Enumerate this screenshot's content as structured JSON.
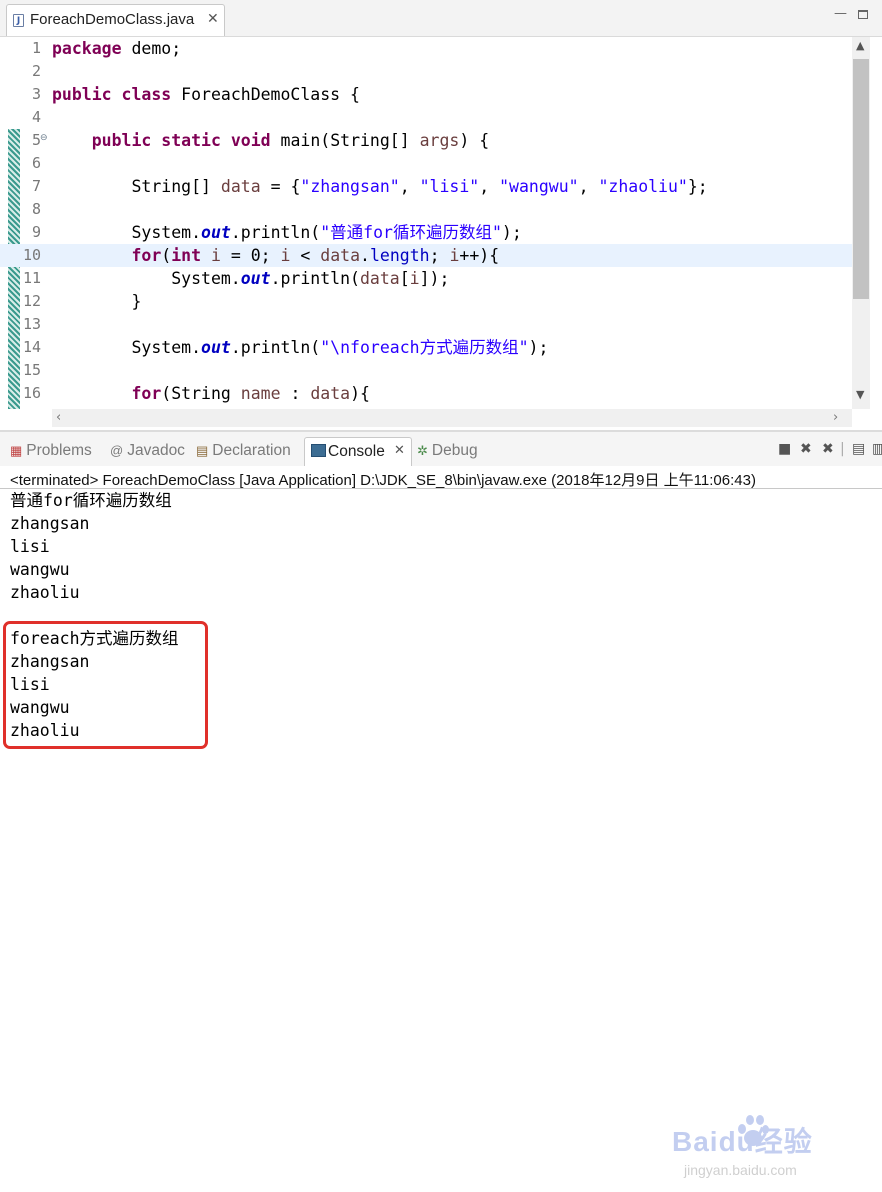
{
  "editor": {
    "tab_label": "ForeachDemoClass.java",
    "file_icon_letter": "J",
    "close_glyph": "✕",
    "lines": [
      {
        "num": "1",
        "tokens": [
          {
            "t": "package",
            "c": "kw"
          },
          {
            "t": " demo;",
            "c": ""
          }
        ]
      },
      {
        "num": "2",
        "tokens": []
      },
      {
        "num": "3",
        "tokens": [
          {
            "t": "public",
            "c": "kw"
          },
          {
            "t": " ",
            "c": ""
          },
          {
            "t": "class",
            "c": "kw"
          },
          {
            "t": " ForeachDemoClass {",
            "c": ""
          }
        ]
      },
      {
        "num": "4",
        "tokens": []
      },
      {
        "num": "5",
        "fold": true,
        "tokens": [
          {
            "t": "    ",
            "c": ""
          },
          {
            "t": "public",
            "c": "kw"
          },
          {
            "t": " ",
            "c": ""
          },
          {
            "t": "static",
            "c": "kw"
          },
          {
            "t": " ",
            "c": ""
          },
          {
            "t": "void",
            "c": "kw"
          },
          {
            "t": " main(String[] ",
            "c": ""
          },
          {
            "t": "args",
            "c": "par"
          },
          {
            "t": ") {",
            "c": ""
          }
        ]
      },
      {
        "num": "6",
        "tokens": []
      },
      {
        "num": "7",
        "tokens": [
          {
            "t": "        String[] ",
            "c": ""
          },
          {
            "t": "data",
            "c": "par"
          },
          {
            "t": " = {",
            "c": ""
          },
          {
            "t": "\"zhangsan\"",
            "c": "str"
          },
          {
            "t": ", ",
            "c": ""
          },
          {
            "t": "\"lisi\"",
            "c": "str"
          },
          {
            "t": ", ",
            "c": ""
          },
          {
            "t": "\"wangwu\"",
            "c": "str"
          },
          {
            "t": ", ",
            "c": ""
          },
          {
            "t": "\"zhaoliu\"",
            "c": "str"
          },
          {
            "t": "};",
            "c": ""
          }
        ]
      },
      {
        "num": "8",
        "tokens": []
      },
      {
        "num": "9",
        "tokens": [
          {
            "t": "        System.",
            "c": ""
          },
          {
            "t": "out",
            "c": "sfld"
          },
          {
            "t": ".println(",
            "c": ""
          },
          {
            "t": "\"普通for循环遍历数组\"",
            "c": "str"
          },
          {
            "t": ");",
            "c": ""
          }
        ]
      },
      {
        "num": "10",
        "current": true,
        "tokens": [
          {
            "t": "        ",
            "c": ""
          },
          {
            "t": "for",
            "c": "kw"
          },
          {
            "t": "(",
            "c": ""
          },
          {
            "t": "int",
            "c": "kw"
          },
          {
            "t": " ",
            "c": ""
          },
          {
            "t": "i",
            "c": "par"
          },
          {
            "t": " = 0; ",
            "c": ""
          },
          {
            "t": "i",
            "c": "par"
          },
          {
            "t": " < ",
            "c": ""
          },
          {
            "t": "data",
            "c": "par"
          },
          {
            "t": ".",
            "c": ""
          },
          {
            "t": "length",
            "c": "fld"
          },
          {
            "t": "; ",
            "c": ""
          },
          {
            "t": "i",
            "c": "par"
          },
          {
            "t": "++){",
            "c": ""
          }
        ]
      },
      {
        "num": "11",
        "tokens": [
          {
            "t": "            System.",
            "c": ""
          },
          {
            "t": "out",
            "c": "sfld"
          },
          {
            "t": ".println(",
            "c": ""
          },
          {
            "t": "data",
            "c": "par"
          },
          {
            "t": "[",
            "c": ""
          },
          {
            "t": "i",
            "c": "par"
          },
          {
            "t": "]);",
            "c": ""
          }
        ]
      },
      {
        "num": "12",
        "tokens": [
          {
            "t": "        }",
            "c": ""
          }
        ]
      },
      {
        "num": "13",
        "tokens": []
      },
      {
        "num": "14",
        "tokens": [
          {
            "t": "        System.",
            "c": ""
          },
          {
            "t": "out",
            "c": "sfld"
          },
          {
            "t": ".println(",
            "c": ""
          },
          {
            "t": "\"\\nforeach方式遍历数组\"",
            "c": "str"
          },
          {
            "t": ");",
            "c": ""
          }
        ]
      },
      {
        "num": "15",
        "tokens": []
      },
      {
        "num": "16",
        "tokens": [
          {
            "t": "        ",
            "c": ""
          },
          {
            "t": "for",
            "c": "kw"
          },
          {
            "t": "(String ",
            "c": ""
          },
          {
            "t": "name",
            "c": "par"
          },
          {
            "t": " : ",
            "c": ""
          },
          {
            "t": "data",
            "c": "par"
          },
          {
            "t": "){",
            "c": ""
          }
        ]
      }
    ]
  },
  "panel": {
    "tabs": {
      "problems": "Problems",
      "javadoc": "Javadoc",
      "declaration": "Declaration",
      "console": "Console",
      "debug": "Debug"
    },
    "terminated_line": "<terminated> ForeachDemoClass [Java Application] D:\\JDK_SE_8\\bin\\javaw.exe (2018年12月9日 上午11:06:43)",
    "output": [
      "普通for循环遍历数组",
      "zhangsan",
      "lisi",
      "wangwu",
      "zhaoliu",
      "",
      "foreach方式遍历数组",
      "zhangsan",
      "lisi",
      "wangwu",
      "zhaoliu"
    ]
  },
  "watermark": {
    "brand": "Baidu经验",
    "url": "jingyan.baidu.com"
  },
  "colors": {
    "keyword": "#7f0055",
    "string": "#2a00ff",
    "field": "#0000c0",
    "highlight_box": "#e0302a",
    "current_line": "#e8f2fe"
  }
}
